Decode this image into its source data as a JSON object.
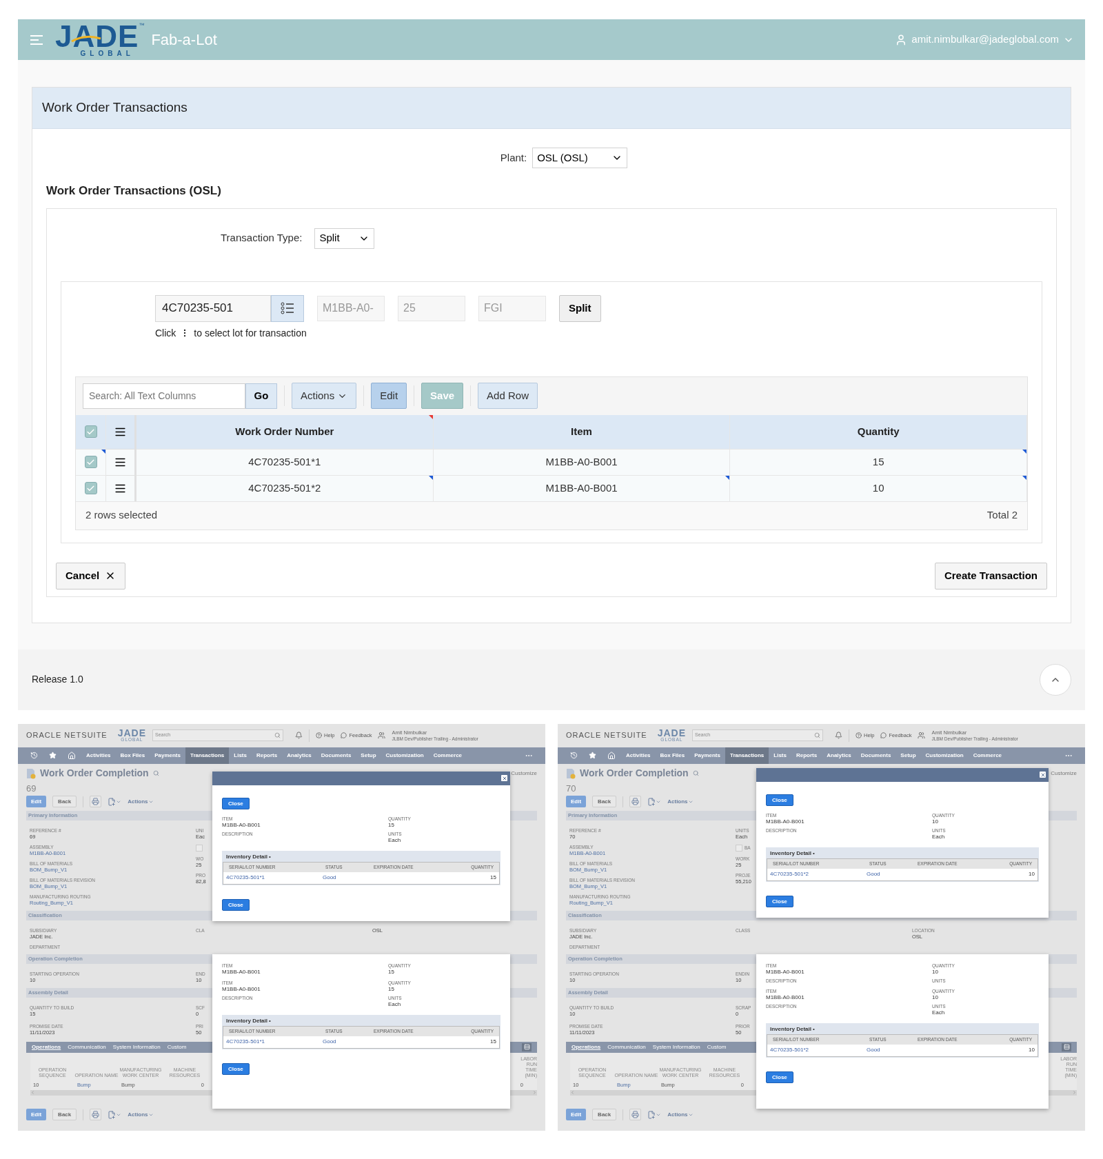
{
  "header": {
    "logo": {
      "word": "JADE",
      "mark": "™",
      "tagline": "GLOBAL"
    },
    "app_name": "Fab-a-Lot",
    "user": "amit.nimbulkar@jadeglobal.com"
  },
  "page": {
    "title": "Work Order Transactions",
    "plant": {
      "label": "Plant:",
      "value": "OSL (OSL)"
    },
    "section_title": "Work Order Transactions (OSL)",
    "transaction_type": {
      "label": "Transaction Type:",
      "value": "Split"
    },
    "lot": {
      "value": "4C70235-501",
      "hint_before": "Click",
      "hint_after": "to select lot for transaction"
    },
    "readonly_fields": [
      "M1BB-A0-",
      "25",
      "FGI"
    ],
    "split_button": "Split",
    "grid": {
      "search": {
        "placeholder": "Search: All Text Columns",
        "go": "Go"
      },
      "toolbar": [
        {
          "label": "Actions",
          "kind": "menu"
        },
        {
          "label": "Edit",
          "kind": "edit"
        },
        {
          "label": "Save",
          "kind": "save"
        },
        {
          "label": "Add Row",
          "kind": "plain"
        }
      ],
      "all_selected": true,
      "columns": [
        {
          "label": "Work Order Number",
          "marked": true
        },
        {
          "label": "Item",
          "marked": false
        },
        {
          "label": "Quantity",
          "marked": false
        }
      ],
      "rows": [
        {
          "selected": true,
          "marked": true,
          "cells": [
            {
              "text": "4C70235-501*1",
              "marked": false
            },
            {
              "text": "M1BB-A0-B001",
              "marked": false
            },
            {
              "text": "15",
              "marked": true
            }
          ]
        },
        {
          "selected": true,
          "marked": false,
          "cells": [
            {
              "text": "4C70235-501*2",
              "marked": true
            },
            {
              "text": "M1BB-A0-B001",
              "marked": true
            },
            {
              "text": "10",
              "marked": true
            }
          ]
        }
      ],
      "selection_text": "2 rows selected",
      "total": "Total 2"
    },
    "cancel": "Cancel",
    "create": "Create Transaction"
  },
  "footer": {
    "release": "Release 1.0"
  },
  "screenshots": [
    {
      "topbar": {
        "oracle": "ORACLE NETSUITE",
        "logo": "JADE",
        "logo_tagline": "GLOBAL",
        "search_placeholder": "Search",
        "help": "Help",
        "feedback": "Feedback",
        "user_name": "Amit Nimbulkar",
        "user_role": "JLBM Dev/Publisher Trailing - Administrator"
      },
      "nav": [
        {
          "label": "Activities",
          "selected": false
        },
        {
          "label": "Box Files",
          "selected": false
        },
        {
          "label": "Payments",
          "selected": false
        },
        {
          "label": "Transactions",
          "selected": true
        },
        {
          "label": "Lists",
          "selected": false
        },
        {
          "label": "Reports",
          "selected": false
        },
        {
          "label": "Analytics",
          "selected": false
        },
        {
          "label": "Documents",
          "selected": false
        },
        {
          "label": "Setup",
          "selected": false
        },
        {
          "label": "Customization",
          "selected": false
        },
        {
          "label": "Commerce",
          "selected": false
        }
      ],
      "title": "Work Order Completion",
      "customize": "Customize",
      "number": "69",
      "actions": {
        "edit": "Edit",
        "back": "Back",
        "actions": "Actions"
      },
      "sections": [
        {
          "title": "Primary Information",
          "columns": [
            [
              {
                "kind": "field",
                "label": "REFERENCE #",
                "value": "69",
                "link": false
              },
              {
                "kind": "field",
                "label": "ASSEMBLY",
                "value": "M1BB-A0-B001",
                "link": true
              },
              {
                "kind": "field",
                "label": "BILL OF MATERIALS",
                "value": "BOM_Bump_V1",
                "link": true
              },
              {
                "kind": "field",
                "label": "BILL OF MATERIALS REVISION",
                "value": "BOM_Bump_V1",
                "link": true
              },
              {
                "kind": "field",
                "label": "MANUFACTURING ROUTING",
                "value": "Routing_Bump_V1",
                "link": true
              }
            ],
            [
              {
                "kind": "field",
                "label": "UNI",
                "value": "Eac",
                "link": false
              },
              {
                "kind": "checkbox",
                "checked": false
              },
              {
                "kind": "field",
                "label": "WO",
                "value": "25",
                "link": false
              },
              {
                "kind": "field",
                "label": "PRO",
                "value": "82,8",
                "link": false
              }
            ],
            []
          ]
        },
        {
          "title": "Classification",
          "columns": [
            [
              {
                "kind": "field",
                "label": "SUBSIDIARY",
                "value": "JADE Inc.",
                "link": false
              },
              {
                "kind": "field",
                "label": "DEPARTMENT"
              }
            ],
            [
              {
                "kind": "field",
                "label": "CLA"
              }
            ],
            [
              {
                "kind": "field",
                "value": "OSL",
                "link": false
              }
            ]
          ]
        },
        {
          "title": "Operation Completion",
          "columns": [
            [
              {
                "kind": "field",
                "label": "STARTING OPERATION",
                "value": "10",
                "link": false
              }
            ],
            [
              {
                "kind": "field",
                "label": "END",
                "value": "10",
                "link": false
              }
            ],
            []
          ]
        },
        {
          "title": "Assembly Detail",
          "columns": [
            [
              {
                "kind": "field",
                "label": "QUANTITY TO BUILD",
                "value": "15",
                "link": false
              }
            ],
            [
              {
                "kind": "field",
                "label": "SCF",
                "value": "0",
                "link": false
              }
            ],
            []
          ]
        },
        {
          "columns": [
            [
              {
                "kind": "field",
                "label": "PROMISE DATE",
                "value": "11/11/2023",
                "link": false
              }
            ],
            [
              {
                "kind": "field",
                "label": "PRI",
                "value": "50",
                "link": false
              }
            ],
            []
          ]
        }
      ],
      "subtabs": [
        {
          "label": "Operations",
          "selected": true
        },
        {
          "label": "Communication",
          "selected": false
        },
        {
          "label": "System Information",
          "selected": false
        },
        {
          "label": "Custom",
          "selected": false
        }
      ],
      "operations": {
        "columns": [
          "OPERATION SEQUENCE",
          "OPERATION NAME",
          "MANUFACTURING WORK CENTER",
          "MACHINE RESOURCES"
        ],
        "end_column": "LABOR RUN TIME (MIN)",
        "row": [
          {
            "text": "10",
            "link": false
          },
          {
            "text": "Bump",
            "link": true
          },
          {
            "text": "Bump",
            "link": false
          },
          {
            "text": "0",
            "link": false
          }
        ],
        "end_value": "0"
      },
      "bottom_actions": {
        "edit": "Edit",
        "back": "Back",
        "actions": "Actions"
      },
      "dialogs": [
        {
          "title_bar": true,
          "close_top": "Close",
          "groups": [
            [
              {
                "label": "ITEM",
                "value": "M1BB-A0-B001"
              },
              {
                "label": "QUANTITY",
                "value": "15"
              },
              {
                "label": "DESCRIPTION"
              },
              {
                "label": "UNITS",
                "value": "Each"
              }
            ]
          ],
          "inventory": {
            "title": "Inventory Detail",
            "marker": "•",
            "columns": [
              "SERIAL/LOT NUMBER",
              "STATUS",
              "EXPIRATION DATE",
              "QUANTITY"
            ],
            "row": {
              "serial": "4C70235-501*1",
              "status": "Good",
              "quantity": "15"
            }
          },
          "close_bottom": "Close"
        },
        {
          "title_bar": false,
          "groups": [
            [
              {
                "label": "ITEM",
                "value": "M1BB-A0-B001"
              },
              {
                "label": "QUANTITY",
                "value": "15"
              }
            ],
            [
              {
                "label": "ITEM",
                "value": "M1BB-A0-B001"
              },
              {
                "label": "QUANTITY",
                "value": "15"
              },
              {
                "label": "DESCRIPTION"
              },
              {
                "label": "UNITS",
                "value": "Each"
              }
            ]
          ],
          "inventory": {
            "title": "Inventory Detail",
            "marker": "•",
            "columns": [
              "SERIAL/LOT NUMBER",
              "STATUS",
              "EXPIRATION DATE",
              "QUANTITY"
            ],
            "row": {
              "serial": "4C70235-501*1",
              "status": "Good",
              "quantity": "15"
            }
          },
          "close_bottom": "Close"
        }
      ]
    },
    {
      "topbar": {
        "oracle": "ORACLE NETSUITE",
        "logo": "JADE",
        "logo_tagline": "GLOBAL",
        "search_placeholder": "Search",
        "help": "Help",
        "feedback": "Feedback",
        "user_name": "Amit Nimbulkar",
        "user_role": "JLBM Dev/Publisher Trailing - Administrator"
      },
      "nav": [
        {
          "label": "Activities",
          "selected": false
        },
        {
          "label": "Box Files",
          "selected": false
        },
        {
          "label": "Payments",
          "selected": false
        },
        {
          "label": "Transactions",
          "selected": true
        },
        {
          "label": "Lists",
          "selected": false
        },
        {
          "label": "Reports",
          "selected": false
        },
        {
          "label": "Analytics",
          "selected": false
        },
        {
          "label": "Documents",
          "selected": false
        },
        {
          "label": "Setup",
          "selected": false
        },
        {
          "label": "Customization",
          "selected": false
        },
        {
          "label": "Commerce",
          "selected": false
        }
      ],
      "title": "Work Order Completion",
      "customize": "Customize",
      "number": "70",
      "actions": {
        "edit": "Edit",
        "back": "Back",
        "actions": "Actions"
      },
      "sections": [
        {
          "title": "Primary Information",
          "columns": [
            [
              {
                "kind": "field",
                "label": "REFERENCE #",
                "value": "70",
                "link": false
              },
              {
                "kind": "field",
                "label": "ASSEMBLY",
                "value": "M1BB-A0-B001",
                "link": true
              },
              {
                "kind": "field",
                "label": "BILL OF MATERIALS",
                "value": "BOM_Bump_V1",
                "link": true
              },
              {
                "kind": "field",
                "label": "BILL OF MATERIALS REVISION",
                "value": "BOM_Bump_V1",
                "link": true
              },
              {
                "kind": "field",
                "label": "MANUFACTURING ROUTING",
                "value": "Routing_Bump_V1",
                "link": true
              }
            ],
            [
              {
                "kind": "field",
                "label": "UNITS",
                "value": "Each",
                "link": false
              },
              {
                "kind": "checkbox",
                "checked": false,
                "label": "BA"
              },
              {
                "kind": "field",
                "label": "WORK",
                "value": "25",
                "link": false
              },
              {
                "kind": "field",
                "label": "PROJE",
                "value": "55,210",
                "link": false
              }
            ],
            []
          ]
        },
        {
          "title": "Classification",
          "columns": [
            [
              {
                "kind": "field",
                "label": "SUBSIDIARY",
                "value": "JADE Inc.",
                "link": false
              },
              {
                "kind": "field",
                "label": "DEPARTMENT"
              }
            ],
            [
              {
                "kind": "field",
                "label": "CLASS"
              }
            ],
            [
              {
                "kind": "field",
                "label": "LOCATION",
                "value": "OSL",
                "link": false
              }
            ]
          ]
        },
        {
          "title": "Operation Completion",
          "columns": [
            [
              {
                "kind": "field",
                "label": "STARTING OPERATION",
                "value": "10",
                "link": false
              }
            ],
            [
              {
                "kind": "field",
                "label": "ENDIN",
                "value": "10",
                "link": false
              }
            ],
            []
          ]
        },
        {
          "title": "Assembly Detail",
          "columns": [
            [
              {
                "kind": "field",
                "label": "QUANTITY TO BUILD",
                "value": "10",
                "link": false
              }
            ],
            [
              {
                "kind": "field",
                "label": "SCRAP",
                "value": "0",
                "link": false
              }
            ],
            []
          ]
        },
        {
          "columns": [
            [
              {
                "kind": "field",
                "label": "PROMISE DATE",
                "value": "11/11/2023",
                "link": false
              }
            ],
            [
              {
                "kind": "field",
                "label": "PRIOR",
                "value": "50",
                "link": false
              }
            ],
            []
          ]
        }
      ],
      "subtabs": [
        {
          "label": "Operations",
          "selected": true
        },
        {
          "label": "Communication",
          "selected": false
        },
        {
          "label": "System Information",
          "selected": false
        },
        {
          "label": "Custom",
          "selected": false
        }
      ],
      "operations": {
        "columns": [
          "OPERATION SEQUENCE",
          "OPERATION NAME",
          "MANUFACTURING WORK CENTER",
          "MACHINE RESOURCES"
        ],
        "end_column": "LABOR RUN TIME (MIN)",
        "row": [
          {
            "text": "10",
            "link": false
          },
          {
            "text": "Bump",
            "link": true
          },
          {
            "text": "Bump",
            "link": false
          },
          {
            "text": "0",
            "link": false
          }
        ]
      },
      "bottom_actions": {
        "edit": "Edit",
        "back": "Back",
        "actions": "Actions"
      },
      "dialogs": [
        {
          "title_bar": true,
          "close_top": "Close",
          "groups": [
            [
              {
                "label": "ITEM",
                "value": "M1BB-A0-B001"
              },
              {
                "label": "QUANTITY",
                "value": "10"
              },
              {
                "label": "DESCRIPTION"
              },
              {
                "label": "UNITS",
                "value": "Each"
              }
            ]
          ],
          "inventory": {
            "title": "Inventory Detail",
            "marker": "•",
            "columns": [
              "SERIAL/LOT NUMBER",
              "STATUS",
              "EXPIRATION DATE",
              "QUANTITY"
            ],
            "row": {
              "serial": "4C70235-501*2",
              "status": "Good",
              "quantity": "10"
            }
          },
          "close_bottom": "Close"
        },
        {
          "title_bar": false,
          "groups": [
            [
              {
                "label": "ITEM",
                "value": "M1BB-A0-B001"
              },
              {
                "label": "QUANTITY",
                "value": "10"
              },
              {
                "label": "DESCRIPTION"
              },
              {
                "label": "UNITS"
              }
            ],
            [
              {
                "label": "ITEM",
                "value": "M1BB-A0-B001"
              },
              {
                "label": "QUANTITY",
                "value": "10"
              },
              {
                "label": "DESCRIPTION"
              },
              {
                "label": "UNITS",
                "value": "Each"
              }
            ]
          ],
          "inventory": {
            "title": "Inventory Detail",
            "marker": "•",
            "columns": [
              "SERIAL/LOT NUMBER",
              "STATUS",
              "EXPIRATION DATE",
              "QUANTITY"
            ],
            "row": {
              "serial": "4C70235-501*2",
              "status": "Good",
              "quantity": "10"
            }
          },
          "close_bottom": "Close"
        }
      ]
    }
  ]
}
